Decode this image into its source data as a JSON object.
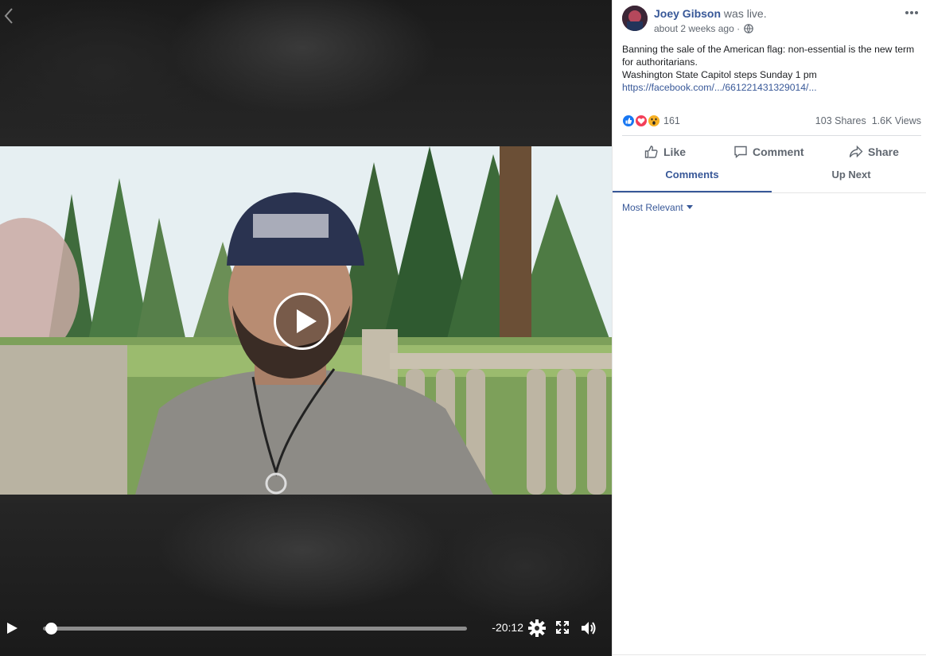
{
  "video": {
    "time_remaining": "-20:12",
    "progress": 0.01
  },
  "post": {
    "author": "Joey Gibson",
    "status": "was live.",
    "timestamp": "about 2 weeks ago",
    "privacy_separator": " · ",
    "body_line1": "Banning the sale of the American flag: non-essential is the new term for authoritarians.",
    "body_line2": "Washington State Capitol steps Sunday 1 pm",
    "link": "https://facebook.com/.../661221431329014/...",
    "reaction_count": "161",
    "shares": "103 Shares",
    "views": "1.6K Views"
  },
  "actions": {
    "like": "Like",
    "comment": "Comment",
    "share": "Share"
  },
  "tabs": {
    "comments": "Comments",
    "up_next": "Up Next"
  },
  "sort": {
    "label": "Most Relevant"
  },
  "colors": {
    "link_blue": "#385898",
    "secondary_text": "#606770",
    "like_blue": "#1877f2",
    "love_red": "#f33e58",
    "wow_yellow": "#f7b125"
  },
  "icons": [
    "back-chevron-icon",
    "play-icon",
    "settings-gear-icon",
    "fullscreen-icon",
    "volume-icon",
    "globe-icon",
    "more-dots-icon",
    "like-reaction-icon",
    "love-reaction-icon",
    "wow-reaction-icon",
    "thumbs-up-icon",
    "comment-bubble-icon",
    "share-arrow-icon",
    "dropdown-caret-icon"
  ]
}
